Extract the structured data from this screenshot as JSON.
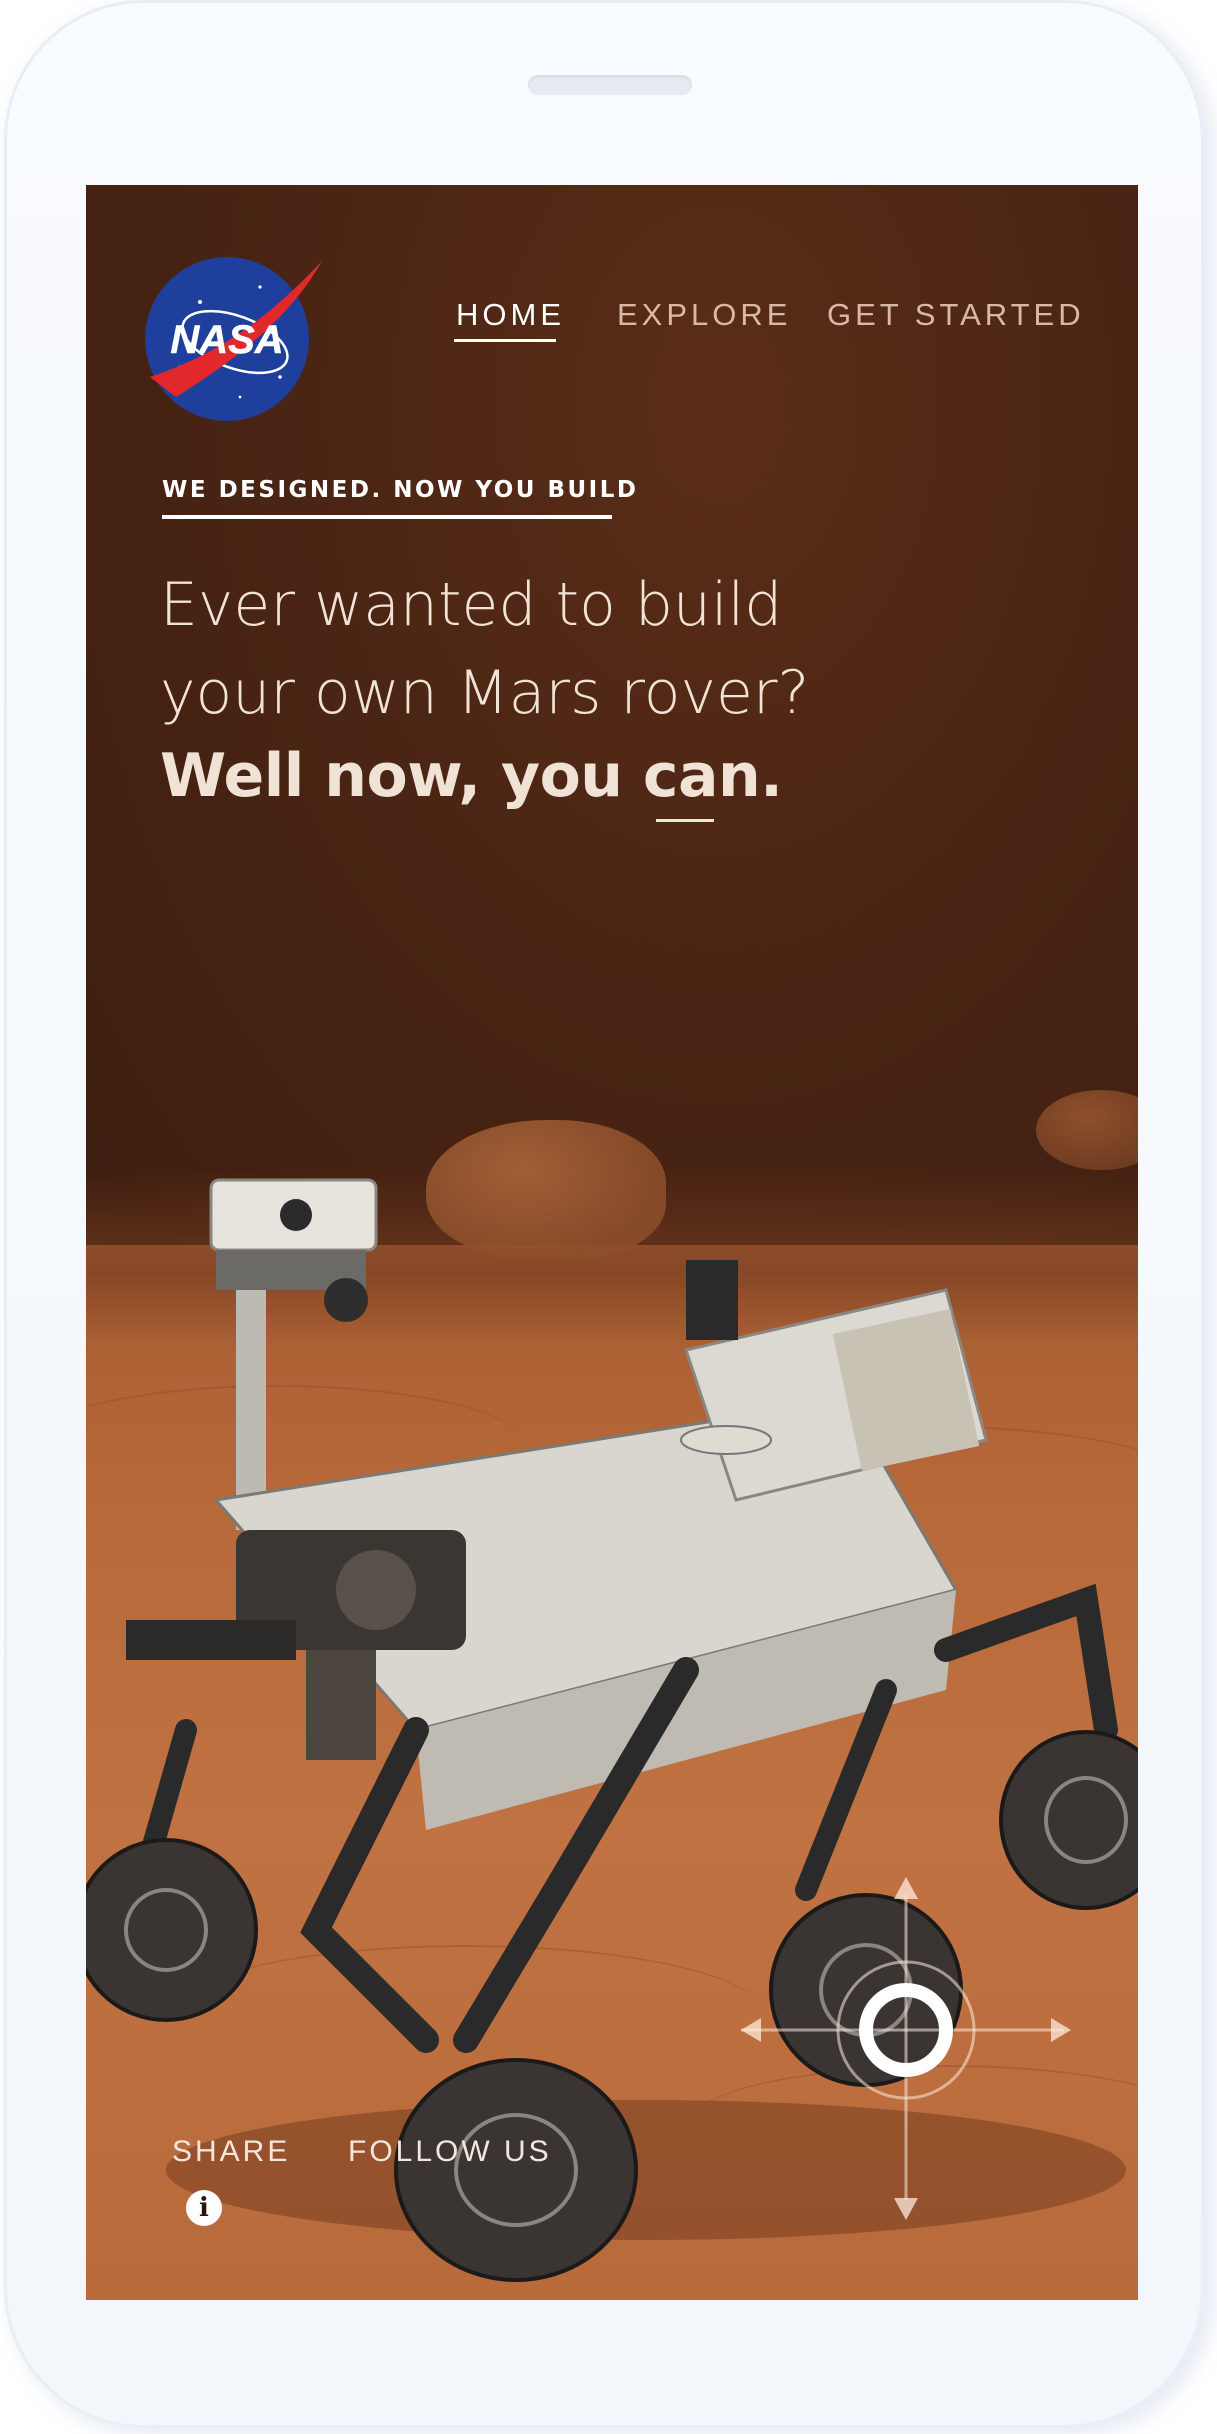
{
  "brand": {
    "logo_text": "NASA"
  },
  "nav": {
    "items": [
      {
        "label": "HOME",
        "active": true
      },
      {
        "label": "EXPLORE",
        "active": false
      },
      {
        "label": "GET STARTED",
        "active": false
      }
    ]
  },
  "hero": {
    "kicker": "WE DESIGNED. NOW YOU BUILD",
    "line1": "Ever wanted to build",
    "line2": "your own Mars rover?",
    "strong": "Well now, you can."
  },
  "footer": {
    "share_label": "SHARE",
    "follow_label": "FOLLOW US",
    "info_glyph": "i"
  },
  "icons": {
    "logo": "nasa-logo",
    "info": "info-icon",
    "controls": "directional-pad-icon"
  },
  "colors": {
    "sky": "#4b2514",
    "ground": "#b8693a",
    "text": "#f1e2d6",
    "nasa_blue": "#1f3f9c",
    "nasa_red": "#e3282c"
  }
}
